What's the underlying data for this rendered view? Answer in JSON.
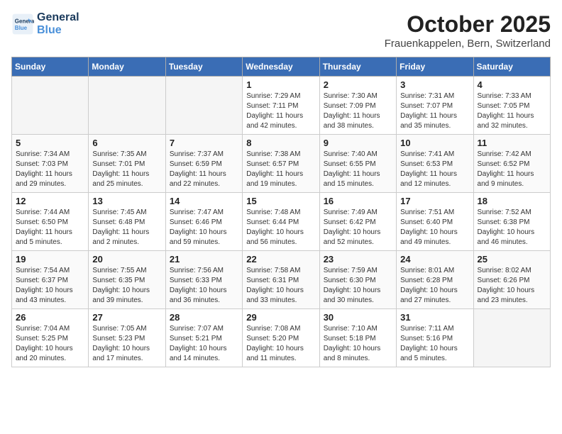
{
  "header": {
    "logo_line1": "General",
    "logo_line2": "Blue",
    "month": "October 2025",
    "location": "Frauenkappelen, Bern, Switzerland"
  },
  "weekdays": [
    "Sunday",
    "Monday",
    "Tuesday",
    "Wednesday",
    "Thursday",
    "Friday",
    "Saturday"
  ],
  "weeks": [
    [
      {
        "day": "",
        "info": ""
      },
      {
        "day": "",
        "info": ""
      },
      {
        "day": "",
        "info": ""
      },
      {
        "day": "1",
        "info": "Sunrise: 7:29 AM\nSunset: 7:11 PM\nDaylight: 11 hours\nand 42 minutes."
      },
      {
        "day": "2",
        "info": "Sunrise: 7:30 AM\nSunset: 7:09 PM\nDaylight: 11 hours\nand 38 minutes."
      },
      {
        "day": "3",
        "info": "Sunrise: 7:31 AM\nSunset: 7:07 PM\nDaylight: 11 hours\nand 35 minutes."
      },
      {
        "day": "4",
        "info": "Sunrise: 7:33 AM\nSunset: 7:05 PM\nDaylight: 11 hours\nand 32 minutes."
      }
    ],
    [
      {
        "day": "5",
        "info": "Sunrise: 7:34 AM\nSunset: 7:03 PM\nDaylight: 11 hours\nand 29 minutes."
      },
      {
        "day": "6",
        "info": "Sunrise: 7:35 AM\nSunset: 7:01 PM\nDaylight: 11 hours\nand 25 minutes."
      },
      {
        "day": "7",
        "info": "Sunrise: 7:37 AM\nSunset: 6:59 PM\nDaylight: 11 hours\nand 22 minutes."
      },
      {
        "day": "8",
        "info": "Sunrise: 7:38 AM\nSunset: 6:57 PM\nDaylight: 11 hours\nand 19 minutes."
      },
      {
        "day": "9",
        "info": "Sunrise: 7:40 AM\nSunset: 6:55 PM\nDaylight: 11 hours\nand 15 minutes."
      },
      {
        "day": "10",
        "info": "Sunrise: 7:41 AM\nSunset: 6:53 PM\nDaylight: 11 hours\nand 12 minutes."
      },
      {
        "day": "11",
        "info": "Sunrise: 7:42 AM\nSunset: 6:52 PM\nDaylight: 11 hours\nand 9 minutes."
      }
    ],
    [
      {
        "day": "12",
        "info": "Sunrise: 7:44 AM\nSunset: 6:50 PM\nDaylight: 11 hours\nand 5 minutes."
      },
      {
        "day": "13",
        "info": "Sunrise: 7:45 AM\nSunset: 6:48 PM\nDaylight: 11 hours\nand 2 minutes."
      },
      {
        "day": "14",
        "info": "Sunrise: 7:47 AM\nSunset: 6:46 PM\nDaylight: 10 hours\nand 59 minutes."
      },
      {
        "day": "15",
        "info": "Sunrise: 7:48 AM\nSunset: 6:44 PM\nDaylight: 10 hours\nand 56 minutes."
      },
      {
        "day": "16",
        "info": "Sunrise: 7:49 AM\nSunset: 6:42 PM\nDaylight: 10 hours\nand 52 minutes."
      },
      {
        "day": "17",
        "info": "Sunrise: 7:51 AM\nSunset: 6:40 PM\nDaylight: 10 hours\nand 49 minutes."
      },
      {
        "day": "18",
        "info": "Sunrise: 7:52 AM\nSunset: 6:38 PM\nDaylight: 10 hours\nand 46 minutes."
      }
    ],
    [
      {
        "day": "19",
        "info": "Sunrise: 7:54 AM\nSunset: 6:37 PM\nDaylight: 10 hours\nand 43 minutes."
      },
      {
        "day": "20",
        "info": "Sunrise: 7:55 AM\nSunset: 6:35 PM\nDaylight: 10 hours\nand 39 minutes."
      },
      {
        "day": "21",
        "info": "Sunrise: 7:56 AM\nSunset: 6:33 PM\nDaylight: 10 hours\nand 36 minutes."
      },
      {
        "day": "22",
        "info": "Sunrise: 7:58 AM\nSunset: 6:31 PM\nDaylight: 10 hours\nand 33 minutes."
      },
      {
        "day": "23",
        "info": "Sunrise: 7:59 AM\nSunset: 6:30 PM\nDaylight: 10 hours\nand 30 minutes."
      },
      {
        "day": "24",
        "info": "Sunrise: 8:01 AM\nSunset: 6:28 PM\nDaylight: 10 hours\nand 27 minutes."
      },
      {
        "day": "25",
        "info": "Sunrise: 8:02 AM\nSunset: 6:26 PM\nDaylight: 10 hours\nand 23 minutes."
      }
    ],
    [
      {
        "day": "26",
        "info": "Sunrise: 7:04 AM\nSunset: 5:25 PM\nDaylight: 10 hours\nand 20 minutes."
      },
      {
        "day": "27",
        "info": "Sunrise: 7:05 AM\nSunset: 5:23 PM\nDaylight: 10 hours\nand 17 minutes."
      },
      {
        "day": "28",
        "info": "Sunrise: 7:07 AM\nSunset: 5:21 PM\nDaylight: 10 hours\nand 14 minutes."
      },
      {
        "day": "29",
        "info": "Sunrise: 7:08 AM\nSunset: 5:20 PM\nDaylight: 10 hours\nand 11 minutes."
      },
      {
        "day": "30",
        "info": "Sunrise: 7:10 AM\nSunset: 5:18 PM\nDaylight: 10 hours\nand 8 minutes."
      },
      {
        "day": "31",
        "info": "Sunrise: 7:11 AM\nSunset: 5:16 PM\nDaylight: 10 hours\nand 5 minutes."
      },
      {
        "day": "",
        "info": ""
      }
    ]
  ]
}
